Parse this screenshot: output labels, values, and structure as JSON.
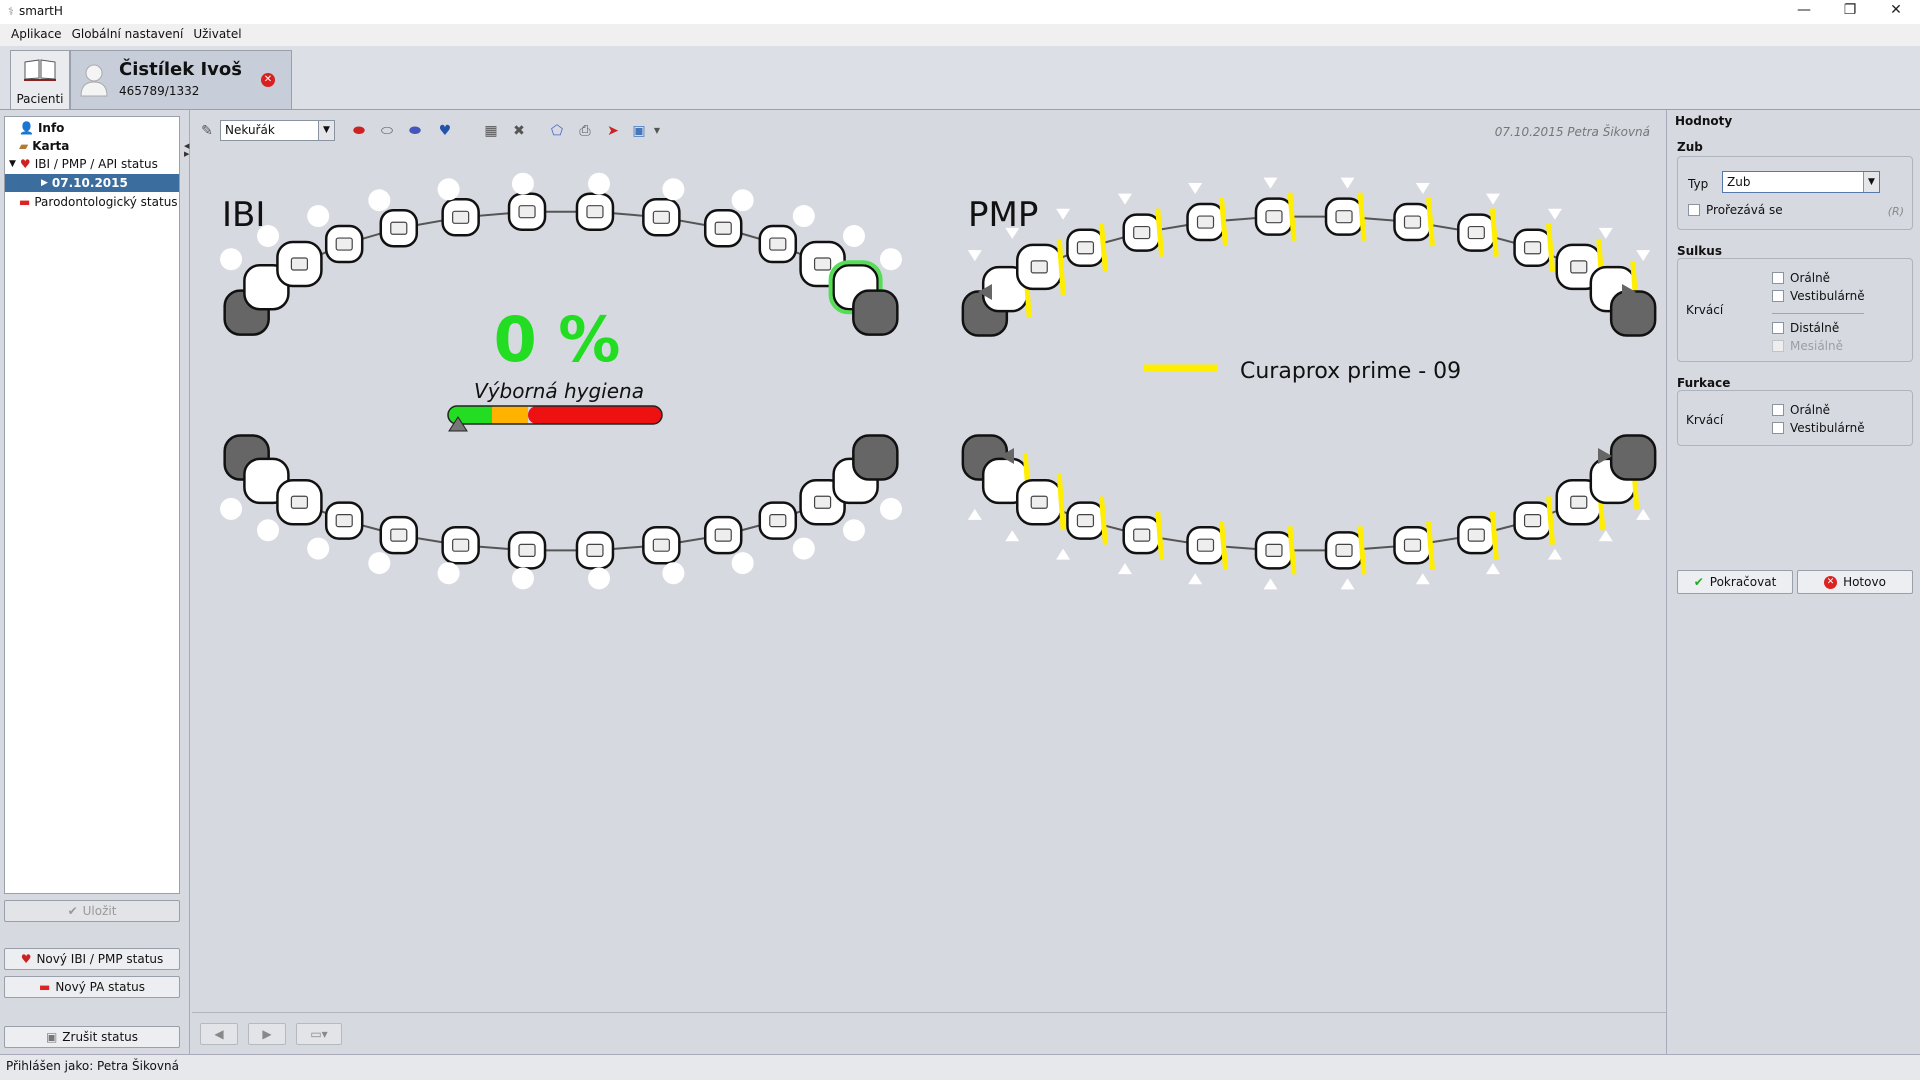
{
  "window": {
    "title": "smartH",
    "minimize": "—",
    "restore": "❐",
    "close": "✕"
  },
  "menu": [
    "Aplikace",
    "Globální nastavení",
    "Uživatel"
  ],
  "tabs": {
    "patients_label": "Pacienti",
    "patient_name": "Čistílek Ivoš",
    "patient_id": "465789/1332"
  },
  "tree": {
    "items": [
      {
        "label": "Info"
      },
      {
        "label": "Karta"
      },
      {
        "label": "IBI / PMP / API status"
      },
      {
        "label": "07.10.2015"
      },
      {
        "label": "Parodontologický status"
      }
    ]
  },
  "left_buttons": {
    "save": "Uložit",
    "new_ibi": "Nový IBI / PMP status",
    "new_pa": "Nový PA status",
    "cancel_status": "Zrušit status"
  },
  "toolbar": {
    "smoker_select": "Nekuřák",
    "date_author": "07.10.2015   Petra Šikovná"
  },
  "ibi": {
    "title": "IBI",
    "percent": "0 %",
    "rating": "Výborná hygiena",
    "indicator_value_pct": 0,
    "colors": {
      "green": "#22dd22",
      "orange": "#ffb300",
      "red": "#ee1111"
    }
  },
  "pmp": {
    "title": "PMP",
    "legend": "Curaprox prime  - 09",
    "legend_color": "#ffee00"
  },
  "right_panel": {
    "title": "Hodnoty",
    "zub": {
      "title": "Zub",
      "typ_label": "Typ",
      "typ_value": "Zub",
      "prorezava_label": "Prořezává se",
      "prorezava_hint": "(R)"
    },
    "sulkus": {
      "title": "Sulkus",
      "row_label": "Krvácí",
      "options": [
        "Orálně",
        "Vestibulárně",
        "Distálně",
        "Mesiálně"
      ]
    },
    "furkace": {
      "title": "Furkace",
      "row_label": "Krvácí",
      "options": [
        "Orálně",
        "Vestibulárně"
      ]
    },
    "continue_label": "Pokračovat",
    "done_label": "Hotovo"
  },
  "statusbar": {
    "text": "Přihlášen jako: Petra Šikovná"
  }
}
